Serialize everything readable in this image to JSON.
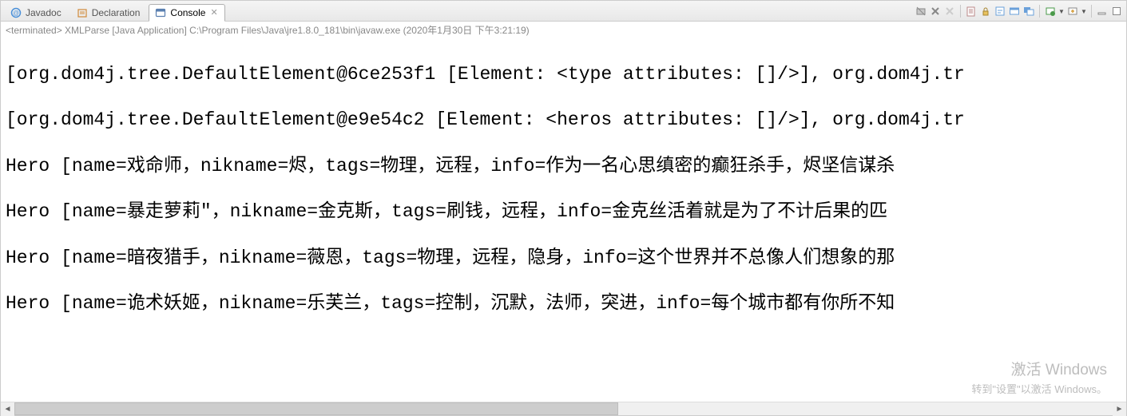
{
  "tabs": {
    "javadoc": {
      "label": "Javadoc"
    },
    "declaration": {
      "label": "Declaration"
    },
    "console": {
      "label": "Console"
    }
  },
  "status": {
    "text": "<terminated> XMLParse [Java Application] C:\\Program Files\\Java\\jre1.8.0_181\\bin\\javaw.exe (2020年1月30日 下午3:21:19)"
  },
  "console": {
    "lines": [
      "[org.dom4j.tree.DefaultElement@6ce253f1 [Element: <type attributes: []/>], org.dom4j.tr",
      "[org.dom4j.tree.DefaultElement@e9e54c2 [Element: <heros attributes: []/>], org.dom4j.tr",
      "Hero [name=戏命师，nikname=烬，tags=物理，远程，info=作为一名心思缜密的癫狂杀手，烬坚信谋杀",
      "Hero [name=暴走萝莉\"，nikname=金克斯，tags=刷钱，远程，info=金克丝活着就是为了不计后果的匹",
      "Hero [name=暗夜猎手，nikname=薇恩，tags=物理，远程，隐身，info=这个世界并不总像人们想象的那",
      "Hero [name=诡术妖姬，nikname=乐芙兰，tags=控制，沉默，法师，突进，info=每个城市都有你所不知"
    ]
  },
  "watermark": {
    "line1": "激活 Windows",
    "line2": "转到\"设置\"以激活 Windows。"
  }
}
